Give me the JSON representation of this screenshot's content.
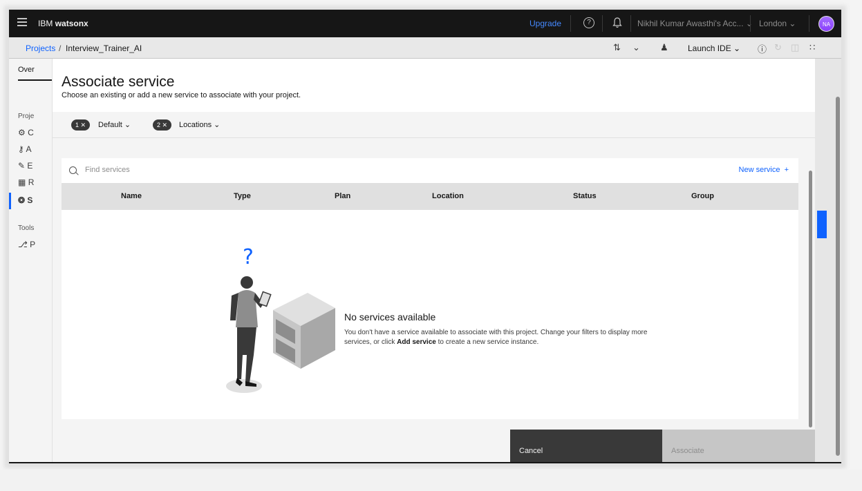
{
  "header": {
    "brand_prefix": "IBM",
    "brand_name": "watsonx",
    "upgrade_label": "Upgrade",
    "account_label": "Nikhil Kumar Awasthi's Acc...",
    "region_label": "London",
    "avatar_initials": "NA"
  },
  "breadcrumb": {
    "projects_link": "Projects",
    "separator": "/",
    "current": "Interview_Trainer_AI",
    "launch_ide_label": "Launch IDE"
  },
  "leftnav": {
    "tab_label": "Over",
    "section_projects": "Proje",
    "items": [
      "C",
      "A",
      "E",
      "R",
      "S"
    ],
    "section_tools": "Tools",
    "tools_items": [
      "P"
    ]
  },
  "modal": {
    "title": "Associate service",
    "subtitle": "Choose an existing or add a new service to associate with your project.",
    "filters": [
      {
        "count": "1",
        "label": "Default"
      },
      {
        "count": "2",
        "label": "Locations"
      }
    ],
    "search_placeholder": "Find services",
    "new_service_label": "New service",
    "columns": [
      "Name",
      "Type",
      "Plan",
      "Location",
      "Status",
      "Group"
    ],
    "empty_state": {
      "title": "No services available",
      "body_before": "You don't have a service available to associate with this project. Change your filters to display more services, or click ",
      "body_bold": "Add service",
      "body_after": " to create a new service instance."
    },
    "cancel_label": "Cancel",
    "associate_label": "Associate"
  },
  "colors": {
    "header_bg": "#161616",
    "link_blue": "#0f62fe",
    "table_header_bg": "#e0e0e0",
    "primary_disabled": "#c6c6c6"
  }
}
